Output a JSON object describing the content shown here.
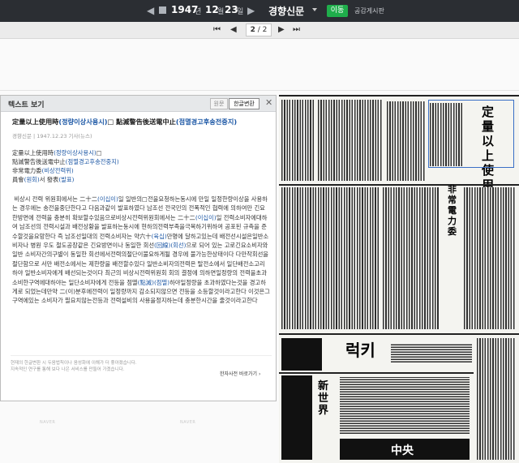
{
  "toolbar": {
    "prev_icon": "◀",
    "next_icon": "▶",
    "calendar_icon": "calendar-icon",
    "year": "1947",
    "year_unit": "년",
    "month": "12",
    "month_unit": "월",
    "day": "23",
    "day_unit": "일",
    "newspaper": "경향신문",
    "go_label": "이동",
    "board_label": "공감게시판"
  },
  "pager": {
    "first_icon": "⏮",
    "prev_icon": "◀",
    "current_page": "2",
    "total_pages": "2",
    "next_icon": "▶",
    "last_icon": "⏭"
  },
  "panel": {
    "title": "텍스트 보기",
    "tab_original": "원문",
    "tab_hangul": "한글변환",
    "close_icon": "✕",
    "headline_a": "定量以上使用時",
    "headline_b": "(정량이상사용시)",
    "headline_c": "□ 點滅警告後送電中止",
    "headline_d": "(점멸경고후송전중지)",
    "meta": "경향신문 | 1947.12.23 기사(뉴스)",
    "sub1_a": "定量以上使用時",
    "sub1_b": "(정량이상사용시)",
    "sub1_c": "□",
    "sub2_a": "點滅警告後送電中止",
    "sub2_b": "(점멸경고후송전중지)",
    "sub3_a": "非常電力委",
    "sub3_b": "(비상전력위)",
    "sub4_a": "員會",
    "sub4_b": "(원회)",
    "sub4_c": "서 發表",
    "sub4_d": "(발표)",
    "body_1": "비상시 전력 위원회에서는 二十二",
    "body_1k": "(이십이)",
    "body_2": "일 일반의□전을요청하는동시에 만일 일정한량이상을 사용하는 경우에는 송전을중단한다고 다음과같이 발표하였다",
    "body_3": "남조선 전국민의 전폭적인 협력에 의하여만 긴요한방면에 전력을 충분히 확보할수있음으로비상시전력위원회에서는 二十二",
    "body_3k": "(이십이)",
    "body_4": "일 전력소비자에대하여 남조선의 전력시설과 배전상황을 발표하는동시에 현하의전력부족을극복하기위하여 공포된 규측을 준수할것을요망한다 즉 남조선일대의 전력소비자는 약六十",
    "body_4k": "(육십)",
    "body_5": "만명에 달하고있는데 배전선시설은일반소비자나 병원 우도 철도공장같은 긴요방면이나 동일한 회선",
    "body_5k": "(回線)(회선)",
    "body_6": "으로 되어 있는 고로긴요소비자와 일반 소비자간의구별이 동일한 회선에서전력의절단이불요하게될 경우에 불가능한상태이다 다만작회선을 절단함으로 서만 배전소에서는 제한량을 배전할수있다 일반소비자의전력은 탈전소에서 일단배전소고리하야 일반소비자에게 배선되는것이다 최근의 비상시전력위원회 회의 결정에 의하면일정량의 전력을초과 소비한구역에대하야는 일단소비자에게 전등을 점멸",
    "body_6k": "(點滅)(점멸)",
    "body_7": "하야일정량을 초과하였다는것을 경고하게로 되었는데만약 二(이)",
    "body_8": "분후에전력이 일정량까지 감소되지않으면 전등을 소등할것이라고한다 이것은그구역에있는 소비자가 필요치않는전등과 전력설비의 사용을정지하는데 충분한시간을 줄것이라고한다",
    "foot_note_1": "현재의 한글변환 시 두음법칙이나 음성화에 이해가 더 좋아졌습니다.",
    "foot_note_2": "지속적인 연구를 통해 보다 나은 서비스를 만들어 가겠습니다.",
    "dict_label": "한자사전 바로가기 ›"
  },
  "watermark": "NAVER",
  "scan": {
    "headline_1": "定量以上使用",
    "headline_2": "非常電力委",
    "ad_1": "럭키",
    "ad_2": "新世界",
    "ad_3": "中央"
  }
}
